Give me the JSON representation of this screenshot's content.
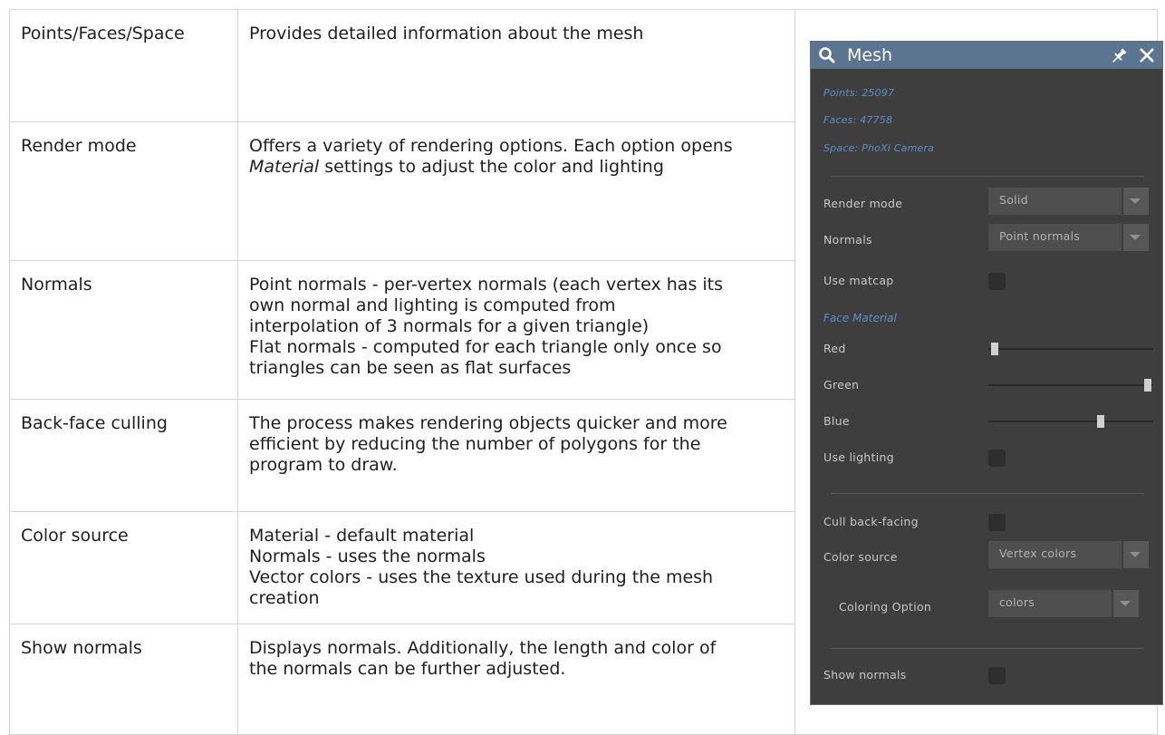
{
  "table": {
    "rows": [
      {
        "feature": "Points/Faces/Space",
        "description": [
          {
            "text": "Provides detailed information about the mesh"
          }
        ]
      },
      {
        "feature": "Render mode",
        "description": [
          {
            "text": "Offers a variety of rendering options. Each option opens"
          },
          {
            "italic": "Material",
            "text": " settings to adjust the color and lighting"
          }
        ]
      },
      {
        "feature": "Normals",
        "description": [
          {
            "text": "Point normals - per-vertex normals (each vertex has its"
          },
          {
            "text": "own normal and lighting is computed from"
          },
          {
            "text": "interpolation of 3 normals for a given triangle)"
          },
          {
            "text": "Flat normals - computed for each triangle only once so"
          },
          {
            "text": "triangles can be seen as flat surfaces"
          }
        ]
      },
      {
        "feature": "Back-face culling",
        "description": [
          {
            "text": "The process makes rendering objects quicker and more"
          },
          {
            "text": "efficient by reducing the number of polygons for the"
          },
          {
            "text": "program to draw."
          }
        ]
      },
      {
        "feature": "Color source",
        "description": [
          {
            "text": "Material - default material"
          },
          {
            "text": "Normals - uses the normals"
          },
          {
            "text": "Vector colors - uses the texture used during the mesh"
          },
          {
            "text": "creation"
          }
        ]
      },
      {
        "feature": "Show normals",
        "description": [
          {
            "text": "Displays normals. Additionally, the length and color of"
          },
          {
            "text": "the normals can be further adjusted."
          }
        ]
      }
    ]
  },
  "panel": {
    "title": "Mesh",
    "icons": {
      "search": "search-icon",
      "pin": "pin-icon",
      "close": "close-icon"
    },
    "colors": {
      "header": "#5b7590",
      "background": "#3e3e3e",
      "accent": "#5d8ec4"
    },
    "info": {
      "points": "Points: 25097",
      "faces": "Faces: 47758",
      "space": "Space: PhoXi Camera"
    },
    "render_mode": {
      "label": "Render mode",
      "value": "Solid"
    },
    "normals": {
      "label": "Normals",
      "value": "Point normals"
    },
    "use_matcap": {
      "label": "Use matcap",
      "checked": false
    },
    "face_material": {
      "label": "Face Material"
    },
    "red": {
      "label": "Red",
      "level": 0.02
    },
    "green": {
      "label": "Green",
      "level": 1.0
    },
    "blue": {
      "label": "Blue",
      "level": 0.7
    },
    "use_lighting": {
      "label": "Use lighting",
      "checked": false
    },
    "cull_back_facing": {
      "label": "Cull back-facing",
      "checked": false
    },
    "color_source": {
      "label": "Color source",
      "value": "Vertex colors"
    },
    "coloring_option": {
      "label": "Coloring Option",
      "value": "colors"
    },
    "show_normals": {
      "label": "Show normals",
      "checked": false
    }
  }
}
